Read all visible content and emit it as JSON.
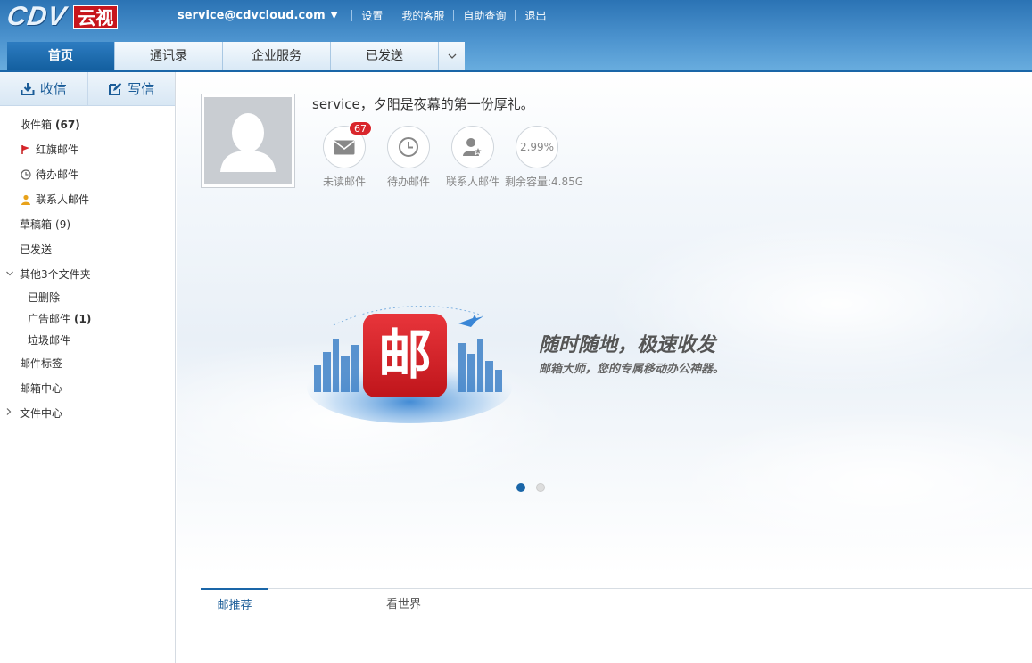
{
  "header": {
    "logo_text": "CDV",
    "logo_badge": "云视",
    "email": "service@cdvcloud.com",
    "links": [
      "设置",
      "我的客服",
      "自助查询",
      "退出"
    ]
  },
  "tabs": [
    {
      "label": "首页",
      "active": true
    },
    {
      "label": "通讯录",
      "active": false
    },
    {
      "label": "企业服务",
      "active": false
    },
    {
      "label": "已发送",
      "active": false
    }
  ],
  "sidebar": {
    "receive_label": "收信",
    "write_label": "写信",
    "folders": {
      "inbox": {
        "label": "收件箱",
        "count": "(67)"
      },
      "flagged": {
        "label": "红旗邮件"
      },
      "todo": {
        "label": "待办邮件"
      },
      "contacts": {
        "label": "联系人邮件"
      },
      "drafts": {
        "label": "草稿箱",
        "count": "(9)"
      },
      "sent": {
        "label": "已发送"
      },
      "other": {
        "label": "其他3个文件夹"
      },
      "deleted": {
        "label": "已删除"
      },
      "ads": {
        "label": "广告邮件",
        "count": "(1)"
      },
      "spam": {
        "label": "垃圾邮件"
      },
      "tags": {
        "label": "邮件标签"
      },
      "center": {
        "label": "邮箱中心"
      },
      "files": {
        "label": "文件中心"
      }
    }
  },
  "main": {
    "greeting": "service，夕阳是夜幕的第一份厚礼。",
    "stats": {
      "unread": {
        "label": "未读邮件",
        "badge": "67"
      },
      "todo": {
        "label": "待办邮件"
      },
      "contacts": {
        "label": "联系人邮件"
      },
      "capacity": {
        "label": "剩余容量:4.85G",
        "percent": "2.99%"
      }
    },
    "banner": {
      "title": "随时随地，极速收发",
      "subtitle": "邮箱大师，您的专属移动办公神器。",
      "app_glyph": "邮",
      "active_slide": 1,
      "slide_count": 2
    },
    "bottom_tabs": [
      {
        "label": "邮推荐",
        "active": true
      },
      {
        "label": "看世界",
        "active": false
      }
    ]
  },
  "colors": {
    "brand_blue": "#1a66a8",
    "badge_red": "#d9262c",
    "app_red": "#d11f24"
  }
}
